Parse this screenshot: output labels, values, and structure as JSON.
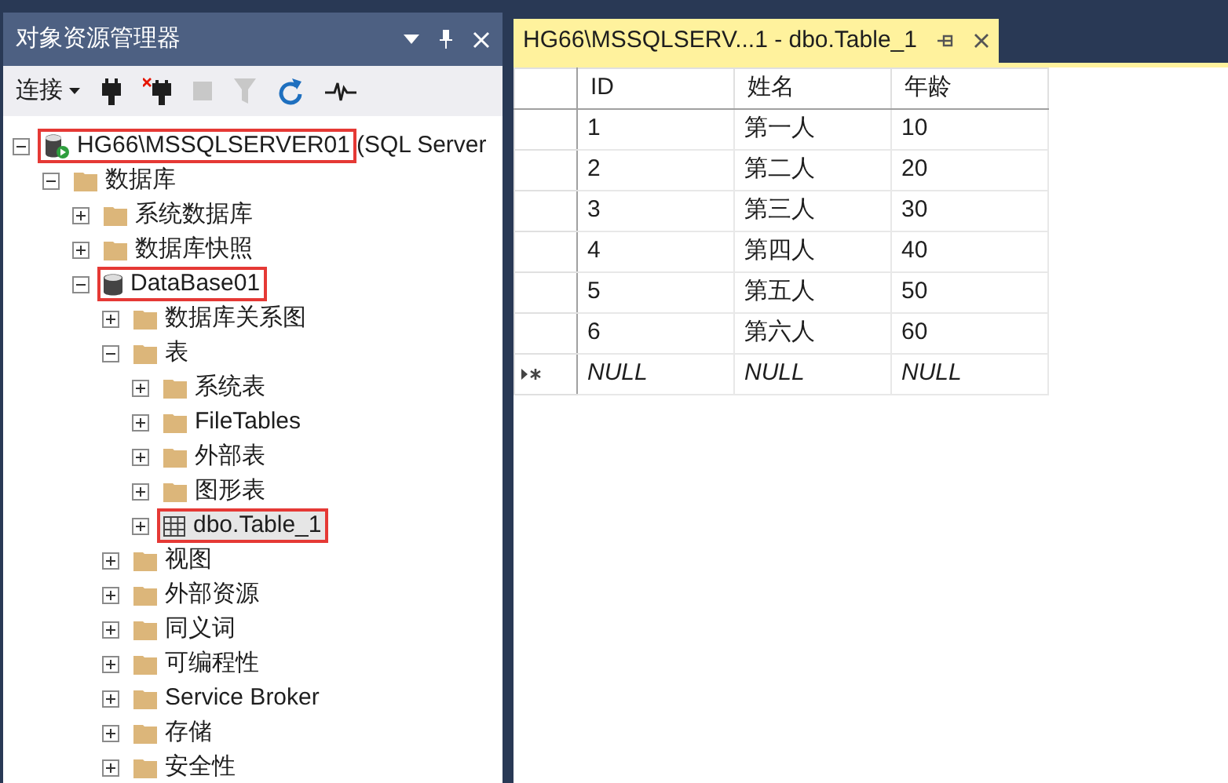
{
  "explorer": {
    "title": "对象资源管理器",
    "connect": "连接"
  },
  "tree": [
    {
      "kind": "server",
      "label": "HG66\\MSSQLSERVER01",
      "suffix": "(SQL Server",
      "expanded": true,
      "highlighted": true,
      "selected": false,
      "children": [
        {
          "kind": "folder",
          "label": "数据库",
          "expanded": true,
          "highlighted": false,
          "selected": false,
          "children": [
            {
              "kind": "folder",
              "label": "系统数据库",
              "expanded": false,
              "highlighted": false,
              "selected": false
            },
            {
              "kind": "folder",
              "label": "数据库快照",
              "expanded": false,
              "highlighted": false,
              "selected": false
            },
            {
              "kind": "database",
              "label": "DataBase01",
              "expanded": true,
              "highlighted": true,
              "selected": false,
              "children": [
                {
                  "kind": "folder",
                  "label": "数据库关系图",
                  "expanded": false,
                  "highlighted": false,
                  "selected": false
                },
                {
                  "kind": "folder",
                  "label": "表",
                  "expanded": true,
                  "highlighted": false,
                  "selected": false,
                  "children": [
                    {
                      "kind": "folder",
                      "label": "系统表",
                      "expanded": false,
                      "highlighted": false,
                      "selected": false
                    },
                    {
                      "kind": "folder",
                      "label": "FileTables",
                      "expanded": false,
                      "highlighted": false,
                      "selected": false
                    },
                    {
                      "kind": "folder",
                      "label": "外部表",
                      "expanded": false,
                      "highlighted": false,
                      "selected": false
                    },
                    {
                      "kind": "folder",
                      "label": "图形表",
                      "expanded": false,
                      "highlighted": false,
                      "selected": false
                    },
                    {
                      "kind": "table",
                      "label": "dbo.Table_1",
                      "expanded": false,
                      "highlighted": true,
                      "selected": true
                    }
                  ]
                },
                {
                  "kind": "folder",
                  "label": "视图",
                  "expanded": false,
                  "highlighted": false,
                  "selected": false
                },
                {
                  "kind": "folder",
                  "label": "外部资源",
                  "expanded": false,
                  "highlighted": false,
                  "selected": false
                },
                {
                  "kind": "folder",
                  "label": "同义词",
                  "expanded": false,
                  "highlighted": false,
                  "selected": false
                },
                {
                  "kind": "folder",
                  "label": "可编程性",
                  "expanded": false,
                  "highlighted": false,
                  "selected": false
                },
                {
                  "kind": "folder",
                  "label": "Service Broker",
                  "expanded": false,
                  "highlighted": false,
                  "selected": false
                },
                {
                  "kind": "folder",
                  "label": "存储",
                  "expanded": false,
                  "highlighted": false,
                  "selected": false
                },
                {
                  "kind": "folder",
                  "label": "安全性",
                  "expanded": false,
                  "highlighted": false,
                  "selected": false
                }
              ]
            }
          ]
        }
      ]
    }
  ],
  "tab": {
    "title": "HG66\\MSSQLSERV...1 - dbo.Table_1"
  },
  "grid": {
    "columns": [
      "ID",
      "姓名",
      "年龄"
    ],
    "rows": [
      {
        "cells": [
          "1",
          "第一人",
          "10"
        ],
        "new_row": false
      },
      {
        "cells": [
          "2",
          "第二人",
          "20"
        ],
        "new_row": false
      },
      {
        "cells": [
          "3",
          "第三人",
          "30"
        ],
        "new_row": false
      },
      {
        "cells": [
          "4",
          "第四人",
          "40"
        ],
        "new_row": false
      },
      {
        "cells": [
          "5",
          "第五人",
          "50"
        ],
        "new_row": false
      },
      {
        "cells": [
          "6",
          "第六人",
          "60"
        ],
        "new_row": false
      },
      {
        "cells": [
          "NULL",
          "NULL",
          "NULL"
        ],
        "new_row": true
      }
    ]
  }
}
